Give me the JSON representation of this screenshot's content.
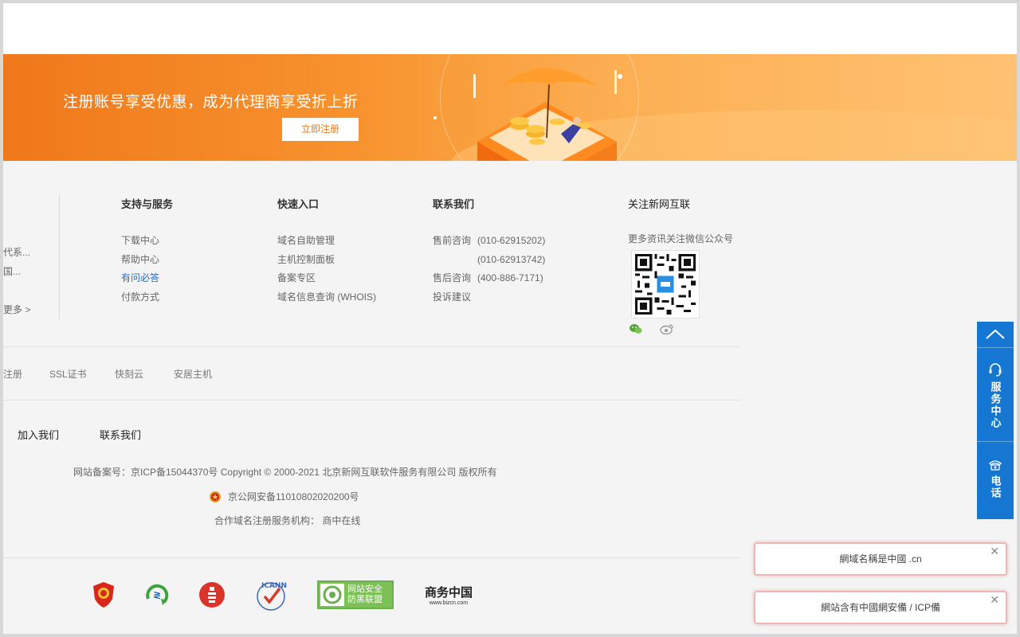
{
  "banner": {
    "title": "注册账号享受优惠，成为代理商享受折上折",
    "cta": "立即注册"
  },
  "left_fragments": [
    "代系...",
    "国...",
    "更多 >"
  ],
  "columns": {
    "support": {
      "title": "支持与服务",
      "links": [
        "下载中心",
        "帮助中心",
        "有问必答",
        "付款方式"
      ]
    },
    "quick": {
      "title": "快速入口",
      "links": [
        "域名自助管理",
        "主机控制面板",
        "备案专区",
        "域名信息查询 (WHOIS)"
      ]
    },
    "contact": {
      "title": "联系我们",
      "rows": [
        {
          "label": "售前咨询",
          "value": "(010-62915202)"
        },
        {
          "label": "",
          "value": "(010-62913742)"
        },
        {
          "label": "售后咨询",
          "value": "(400-886-7171)"
        },
        {
          "label": "投诉建议",
          "value": ""
        }
      ]
    },
    "follow": {
      "title": "关注新网互联",
      "subtitle": "更多资讯关注微信公众号"
    }
  },
  "products": [
    "注册",
    "SSL证书",
    "快刻云",
    "安居主机"
  ],
  "about": [
    "加入我们",
    "联系我们"
  ],
  "footer": {
    "copyright": "网站备案号：京ICP备15044370号 Copyright © 2000-2021 北京新网互联软件服务有限公司 版权所有",
    "police": "京公网安备11010802020200号",
    "partner": "合作域名注册服务机构：  商中在线"
  },
  "certs": {
    "green_badge": "网站安全\n防黑联盟",
    "green_badge_line1": "网站安全",
    "green_badge_line2": "防黑联盟",
    "bizcn_cn": "商务中国",
    "bizcn_url": "www.bizcn.com",
    "icann": "ICANN"
  },
  "side": {
    "service": "服务中心",
    "phone": "电话"
  },
  "toasts": [
    "網域名稱是中國 .cn",
    "網站含有中國網安備 / ICP備"
  ],
  "colors": {
    "brand_orange": "#f0781a",
    "side_blue": "#1677d2",
    "link_blue": "#2a6cbf"
  }
}
